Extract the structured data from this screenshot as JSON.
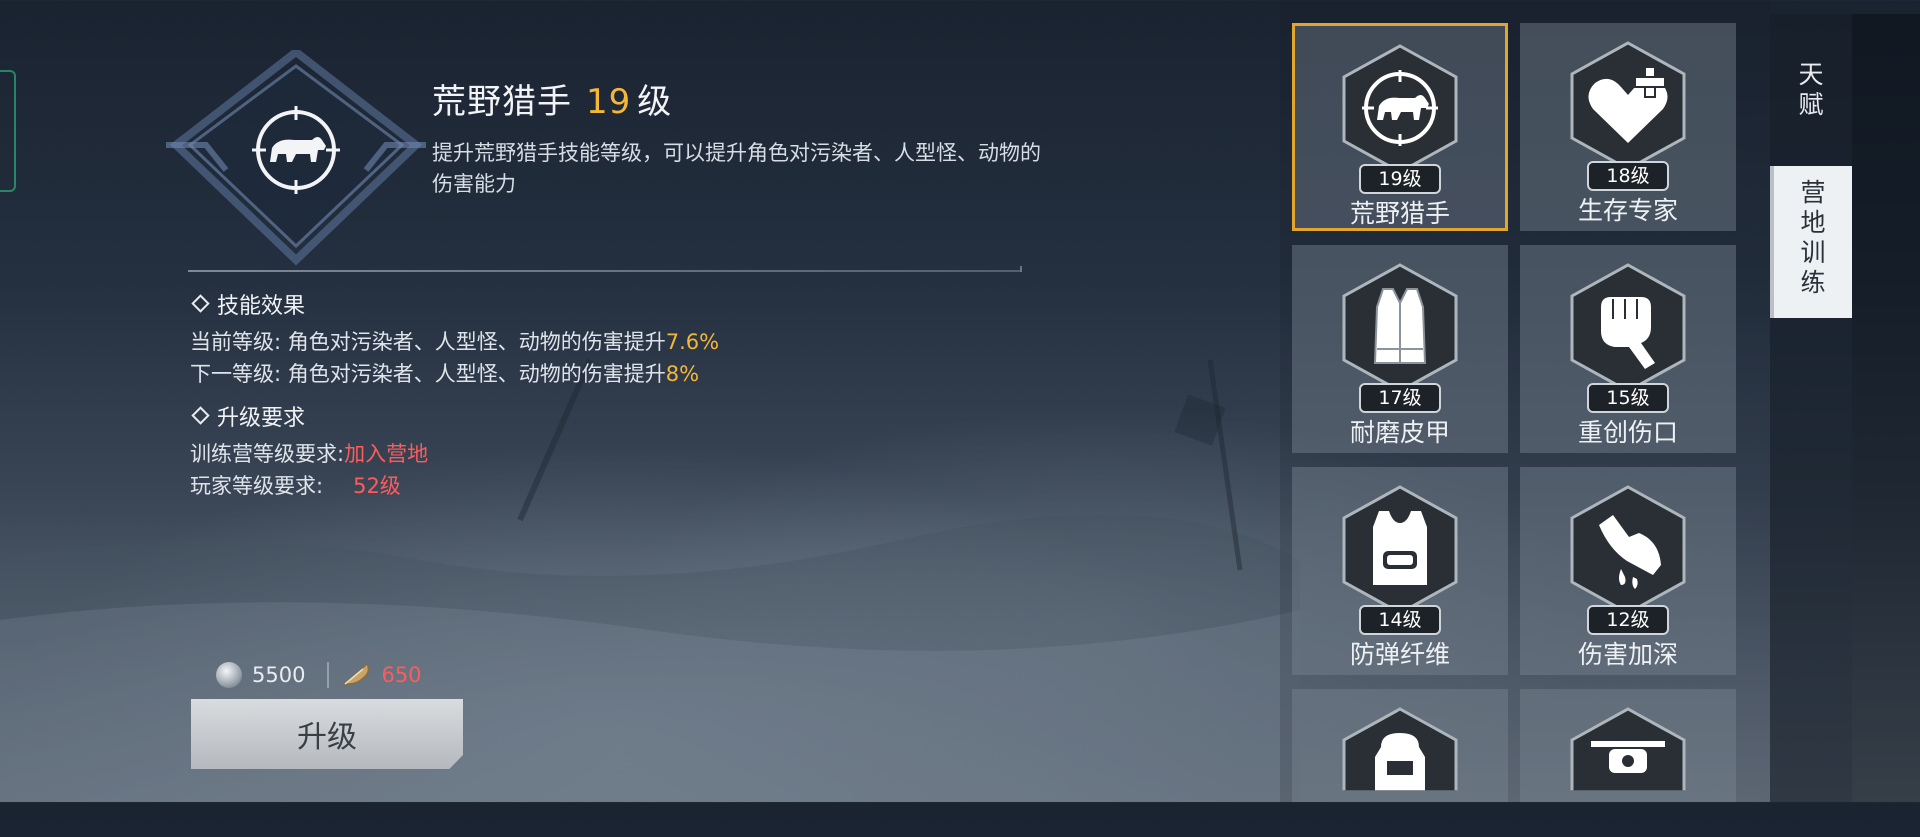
{
  "skill": {
    "name": "荒野猎手",
    "level": "19",
    "level_unit": "级",
    "description": "提升荒野猎手技能等级，可以提升角色对污染者、人型怪、动物的伤害能力"
  },
  "effects": {
    "header": "技能效果",
    "current_label": "当前等级: 角色对污染者、人型怪、动物的伤害提升",
    "current_value": "7.6%",
    "next_label": "下一等级: 角色对污染者、人型怪、动物的伤害提升",
    "next_value": "8%"
  },
  "requirements": {
    "header": "升级要求",
    "camp_label": "训练营等级要求:",
    "camp_value": "加入营地",
    "player_label": "玩家等级要求:",
    "player_value": "52级"
  },
  "cost": {
    "silver": "5500",
    "feather": "650"
  },
  "upgrade_button": "升级",
  "skills_grid": [
    {
      "name": "荒野猎手",
      "level": "19级",
      "icon": "bear-crosshair-icon",
      "selected": true
    },
    {
      "name": "生存专家",
      "level": "18级",
      "icon": "heart-plus-icon",
      "selected": false
    },
    {
      "name": "耐磨皮甲",
      "level": "17级",
      "icon": "leather-vest-icon",
      "selected": false
    },
    {
      "name": "重创伤口",
      "level": "15级",
      "icon": "fist-icon",
      "selected": false
    },
    {
      "name": "防弹纤维",
      "level": "14级",
      "icon": "bulletproof-vest-icon",
      "selected": false
    },
    {
      "name": "伤害加深",
      "level": "12级",
      "icon": "bleeding-hand-icon",
      "selected": false
    },
    {
      "name": "",
      "level": "",
      "icon": "backpack-icon",
      "selected": false
    },
    {
      "name": "",
      "level": "",
      "icon": "drone-icon",
      "selected": false
    }
  ],
  "side_tabs": [
    {
      "label": "天赋",
      "active": false
    },
    {
      "label": "营地训练",
      "active": true
    }
  ],
  "colors": {
    "highlight_gold": "#f4b738",
    "requirement_red": "#ff5b5b",
    "selected_border": "#e4a52c"
  }
}
